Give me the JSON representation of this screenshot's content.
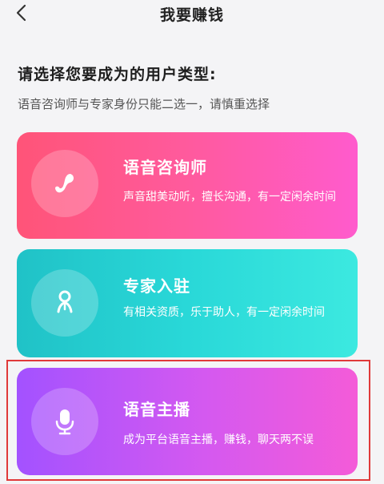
{
  "header": {
    "back_icon": "chevron-left-icon",
    "title": "我要赚钱"
  },
  "intro": {
    "heading": "请选择您要成为的用户类型:",
    "subheading": "语音咨询师与专家身份只能二选一，请慎重选择"
  },
  "options": [
    {
      "title": "语音咨询师",
      "description": "声音甜美动听，擅长沟通，有一定闲余时间",
      "icon": "phone-icon",
      "gradient": [
        "#ff5478",
        "#ff5bcd"
      ]
    },
    {
      "title": "专家入驻",
      "description": "有相关资质，乐于助人，有一定闲余时间",
      "icon": "expert-person-icon",
      "gradient": [
        "#20c2c7",
        "#3ce9e0"
      ]
    },
    {
      "title": "语音主播",
      "description": "成为平台语音主播，赚钱，聊天两不误",
      "icon": "microphone-icon",
      "gradient": [
        "#a352ff",
        "#f45bd8"
      ]
    }
  ],
  "highlight_color": "#e03a3a"
}
